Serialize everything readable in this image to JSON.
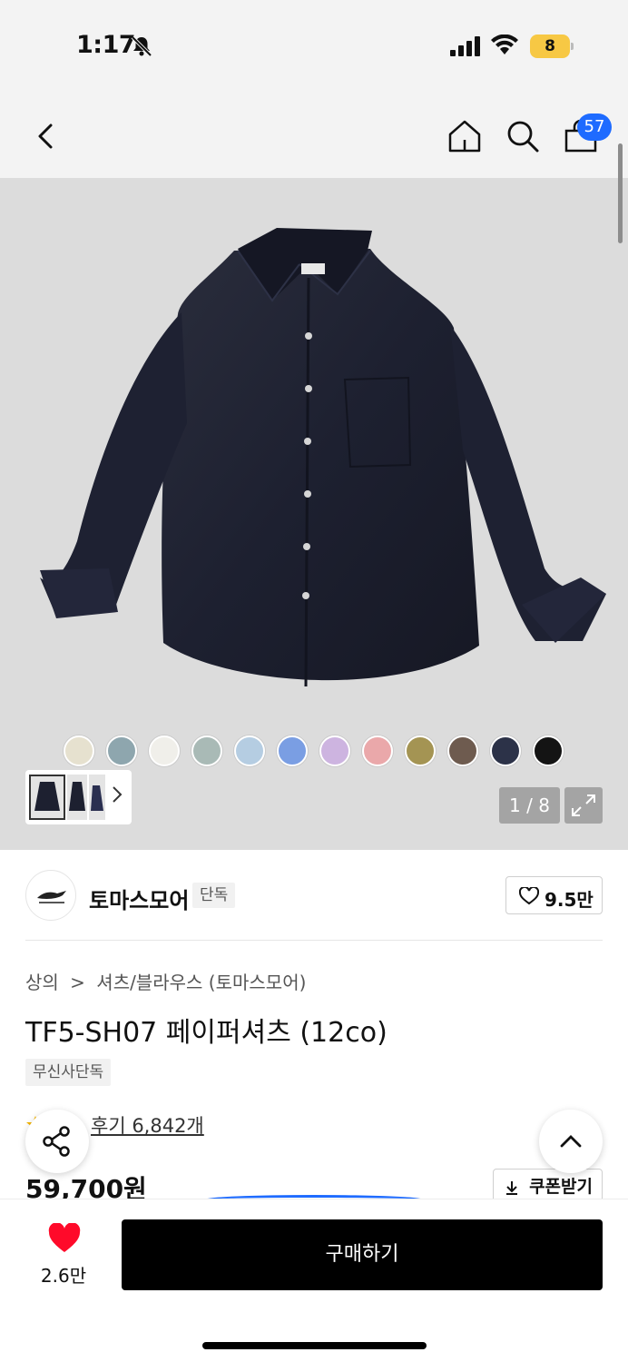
{
  "status_bar": {
    "time": "1:17",
    "battery": "8"
  },
  "nav": {
    "cart_count": "57"
  },
  "hero": {
    "page_counter": "1 / 8",
    "swatches": [
      "#e6e1cf",
      "#8ea6ae",
      "#f0efea",
      "#a9bab6",
      "#b5cde2",
      "#7a9ee3",
      "#cdb4e0",
      "#eaa8aa",
      "#a49453",
      "#6e5b4f",
      "#2c3248",
      "#141414"
    ]
  },
  "brand": {
    "name": "토마스모어",
    "exclusive": "단독",
    "likes": "9.5만"
  },
  "product": {
    "breadcrumb": [
      "상의",
      ">",
      "셔츠/블라우스 (토마스모어)"
    ],
    "title": "TF5-SH07 페이퍼셔츠 (12co)",
    "tag": "무신사단독",
    "review": "후기 6,842개",
    "price": "59,700원",
    "coupon_label": "쿠폰받기"
  },
  "bottom": {
    "likes": "2.6만",
    "buy_label": "구매하기"
  }
}
